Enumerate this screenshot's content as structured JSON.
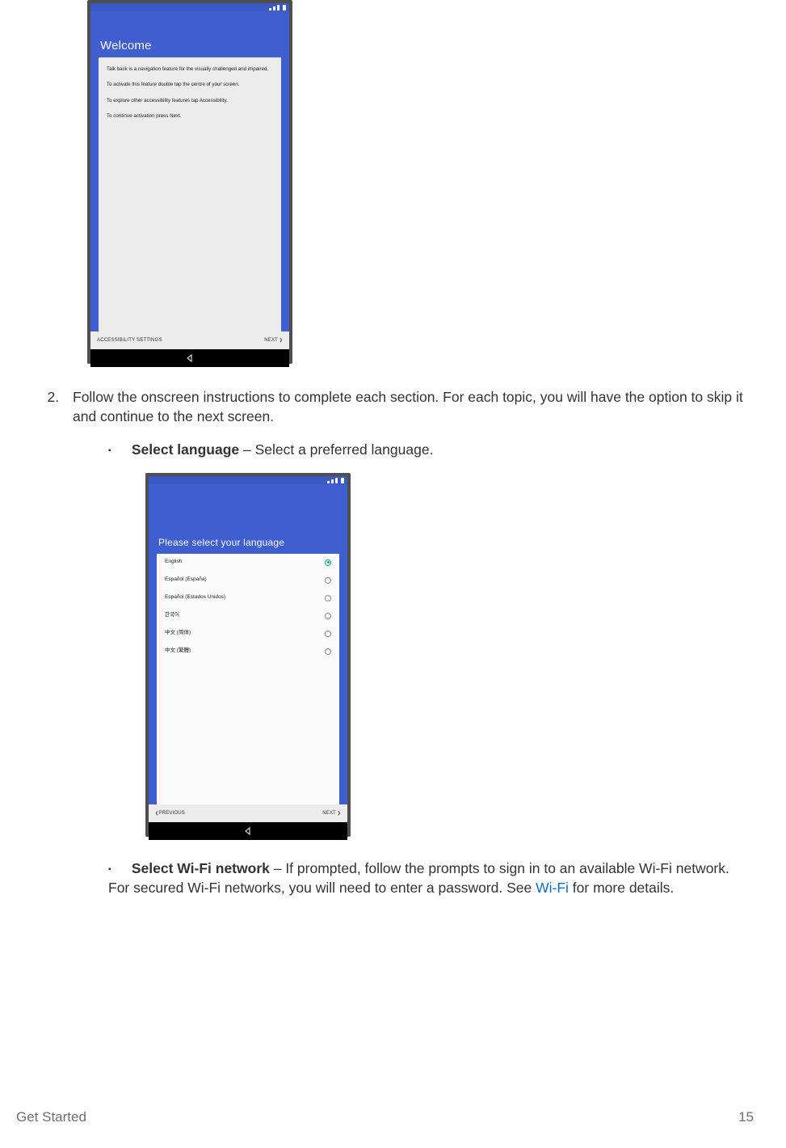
{
  "phone1": {
    "title": "Welcome",
    "lines": [
      "Talk back is a navigation feature for the visually challenged and impaired.",
      "To activate this feature double tap the centre of your screen.",
      "To explore other accessibility features tap Accessibility.",
      "To continue activation press Next."
    ],
    "left_btn": "ACCESSIBILITY SETTINGS",
    "right_btn": "NEXT"
  },
  "step2": {
    "text": "Follow the onscreen instructions to complete each section. For each topic, you will have the option to skip it and continue to the next screen."
  },
  "bullet_lang": {
    "bold": "Select language",
    "rest": " – Select a preferred language."
  },
  "phone2": {
    "title": "Please select your language",
    "langs": [
      {
        "label": "English",
        "selected": true
      },
      {
        "label": "Español (España)",
        "selected": false
      },
      {
        "label": "Español (Estados Unidos)",
        "selected": false
      },
      {
        "label": "한국어",
        "selected": false
      },
      {
        "label": "中文 (简体)",
        "selected": false
      },
      {
        "label": "中文 (繁體)",
        "selected": false
      }
    ],
    "left_btn": "PREVIOUS",
    "right_btn": "NEXT"
  },
  "bullet_wifi": {
    "bold": "Select Wi-Fi network",
    "part1": " – If prompted, follow the prompts to sign in to an available Wi-Fi network. For secured Wi-Fi networks, you will need to enter a password. See ",
    "link": "Wi-Fi",
    "part2": " for more details."
  },
  "footer": {
    "section": "Get Started",
    "page": "15"
  }
}
